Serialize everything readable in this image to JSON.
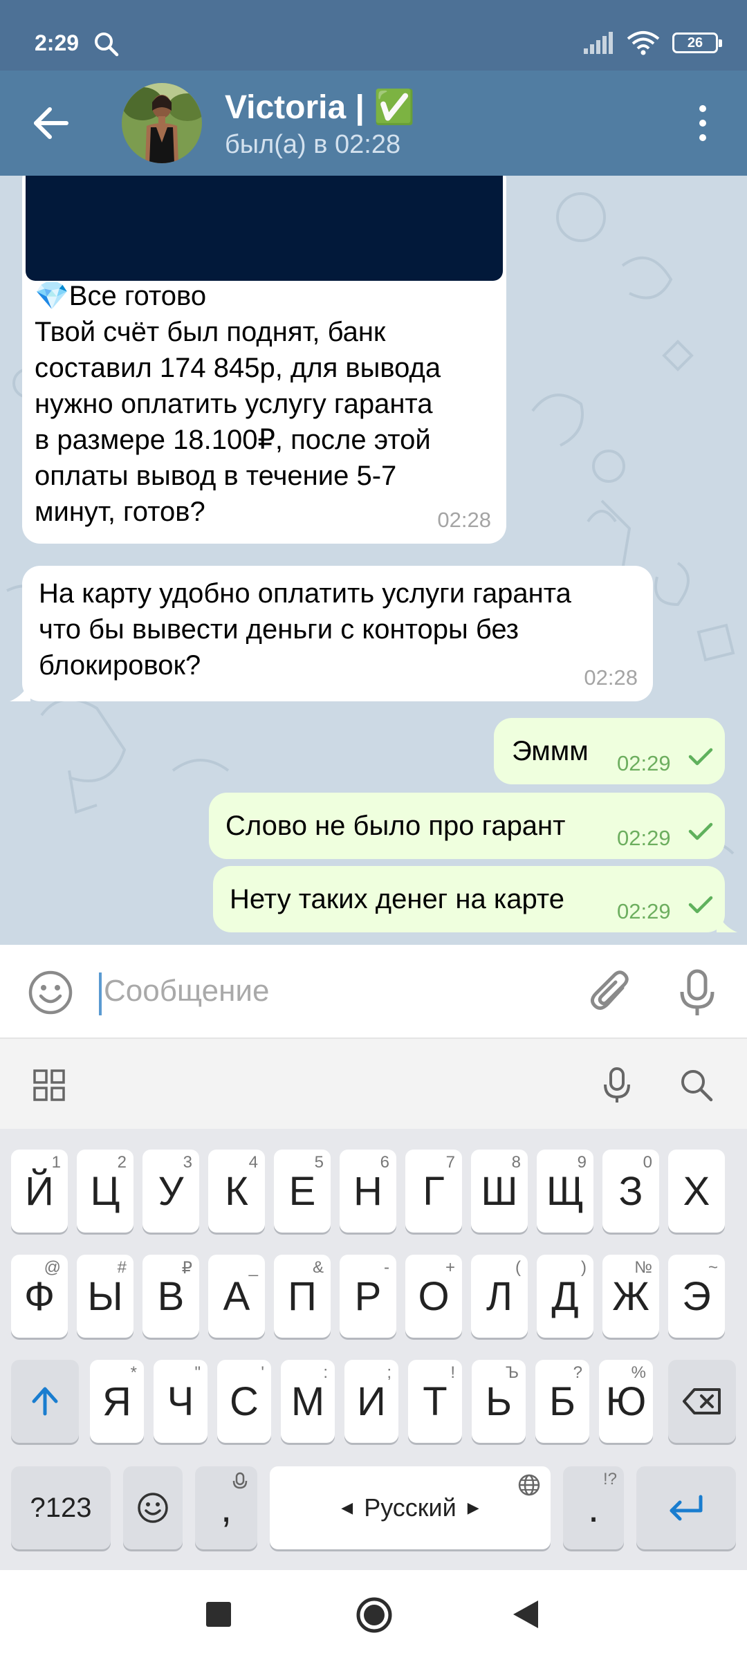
{
  "status_bar": {
    "time": "2:29",
    "battery": "26"
  },
  "header": {
    "title": "Victoria | ✅",
    "subtitle": "был(а) в 02:28"
  },
  "messages": [
    {
      "direction": "incoming",
      "lines": [
        "💎Все готово",
        "Твой счёт был поднят, банк",
        "составил 174 845р, для вывода",
        "нужно оплатить услугу гаранта",
        "в размере 18.100₽, после этой",
        "оплаты вывод в течение 5-7",
        "минут, готов?"
      ],
      "time": "02:28"
    },
    {
      "direction": "incoming",
      "lines": [
        "На карту удобно оплатить услуги гаранта",
        "что бы вывести деньги с конторы без",
        "блокировок?"
      ],
      "time": "02:28"
    },
    {
      "direction": "outgoing",
      "text": "Эммм",
      "time": "02:29"
    },
    {
      "direction": "outgoing",
      "text": "Слово не было про гарант",
      "time": "02:29"
    },
    {
      "direction": "outgoing",
      "text": "Нету таких денег на карте",
      "time": "02:29"
    }
  ],
  "input": {
    "placeholder": "Сообщение"
  },
  "keyboard": {
    "row1": [
      {
        "key": "Й",
        "hint": "1"
      },
      {
        "key": "Ц",
        "hint": "2"
      },
      {
        "key": "У",
        "hint": "3"
      },
      {
        "key": "К",
        "hint": "4"
      },
      {
        "key": "Е",
        "hint": "5"
      },
      {
        "key": "Н",
        "hint": "6"
      },
      {
        "key": "Г",
        "hint": "7"
      },
      {
        "key": "Ш",
        "hint": "8"
      },
      {
        "key": "Щ",
        "hint": "9"
      },
      {
        "key": "З",
        "hint": "0"
      },
      {
        "key": "Х",
        "hint": ""
      }
    ],
    "row2": [
      {
        "key": "Ф",
        "hint": "@"
      },
      {
        "key": "Ы",
        "hint": "#"
      },
      {
        "key": "В",
        "hint": "₽"
      },
      {
        "key": "А",
        "hint": "_"
      },
      {
        "key": "П",
        "hint": "&"
      },
      {
        "key": "Р",
        "hint": "-"
      },
      {
        "key": "О",
        "hint": "+"
      },
      {
        "key": "Л",
        "hint": "("
      },
      {
        "key": "Д",
        "hint": ")"
      },
      {
        "key": "Ж",
        "hint": "№"
      },
      {
        "key": "Э",
        "hint": "~"
      }
    ],
    "row3": [
      {
        "key": "Я",
        "hint": "*"
      },
      {
        "key": "Ч",
        "hint": "\""
      },
      {
        "key": "С",
        "hint": "'"
      },
      {
        "key": "М",
        "hint": ":"
      },
      {
        "key": "И",
        "hint": ";"
      },
      {
        "key": "Т",
        "hint": "!"
      },
      {
        "key": "Ь",
        "hint": "Ъ"
      },
      {
        "key": "Б",
        "hint": "?"
      },
      {
        "key": "Ю",
        "hint": "%"
      }
    ],
    "symbols_label": "?123",
    "comma": ",",
    "space_label": "Русский",
    "period": ".",
    "period_hint": "!?"
  }
}
